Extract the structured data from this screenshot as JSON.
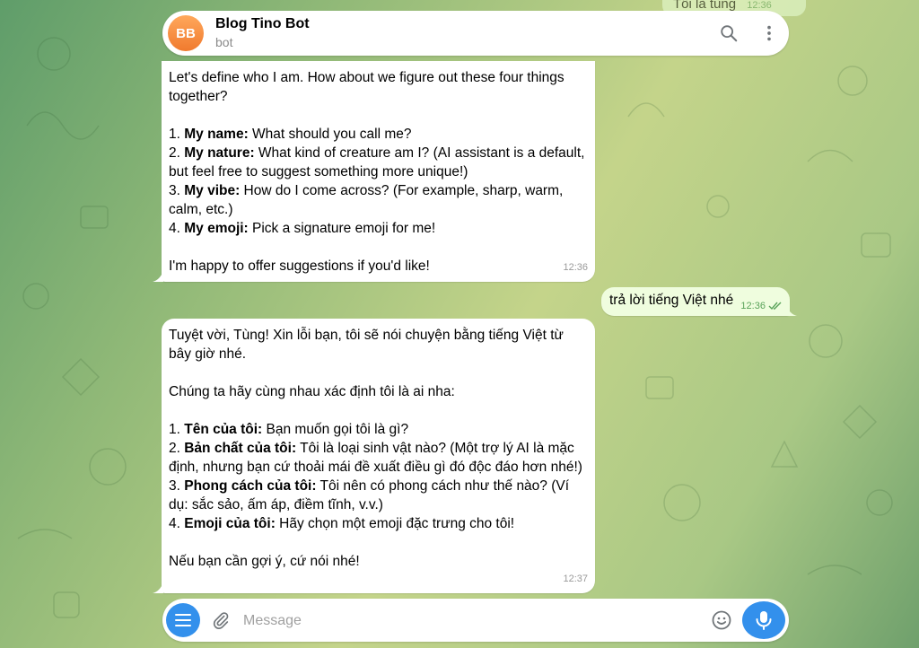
{
  "header": {
    "avatar_initials": "BB",
    "title": "Blog Tino Bot",
    "subtitle": "bot"
  },
  "peek_message": {
    "text": "Tôi là tùng",
    "time": "12:36"
  },
  "messages": {
    "bot1": {
      "intro": "Let's define who I am. How about we figure out these four things together?",
      "items": [
        {
          "bold": "My name:",
          "text": " What should you call me?"
        },
        {
          "bold": "My nature:",
          "text": " What kind of creature am I? (AI assistant is a default, but feel free to suggest something more unique!)"
        },
        {
          "bold": "My vibe:",
          "text": " How do I come across? (For example, sharp, warm, calm, etc.)"
        },
        {
          "bold": "My emoji:",
          "text": " Pick a signature emoji for me!"
        }
      ],
      "numbers": [
        "1. ",
        "2. ",
        "3. ",
        "4. "
      ],
      "outro": "I'm happy to offer suggestions if you'd like!",
      "time": "12:36"
    },
    "user1": {
      "text": "trả lời tiếng Việt nhé",
      "time": "12:36"
    },
    "bot2": {
      "line1": "Tuyệt vời, Tùng! Xin lỗi bạn, tôi sẽ nói chuyện bằng tiếng Việt từ bây giờ nhé.",
      "intro": "Chúng ta hãy cùng nhau xác định tôi là ai nha:",
      "items": [
        {
          "bold": "Tên của tôi:",
          "text": " Bạn muốn gọi tôi là gì?"
        },
        {
          "bold": "Bản chất của tôi:",
          "text": " Tôi là loại sinh vật nào? (Một trợ lý AI là mặc định, nhưng bạn cứ thoải mái đề xuất điều gì đó độc đáo hơn nhé!)"
        },
        {
          "bold": "Phong cách của tôi:",
          "text": " Tôi nên có phong cách như thế nào? (Ví dụ: sắc sảo, ấm áp, điềm tĩnh, v.v.)"
        },
        {
          "bold": "Emoji của tôi:",
          "text": " Hãy chọn một emoji đặc trưng cho tôi!"
        }
      ],
      "numbers": [
        "1. ",
        "2. ",
        "3. ",
        "4. "
      ],
      "outro": "Nếu bạn cần gợi ý, cứ nói nhé!",
      "time": "12:37"
    }
  },
  "composer": {
    "placeholder": "Message"
  },
  "icons": {
    "search": "search-icon",
    "more": "more-vertical-icon",
    "menu": "menu-icon",
    "attach": "paperclip-icon",
    "emoji": "smile-icon",
    "mic": "microphone-icon",
    "read": "double-check-icon"
  },
  "colors": {
    "accent": "#3390ec",
    "outgoing_bubble": "#effdde",
    "avatar": "#f58a3c",
    "read_check": "#5aa35a"
  }
}
